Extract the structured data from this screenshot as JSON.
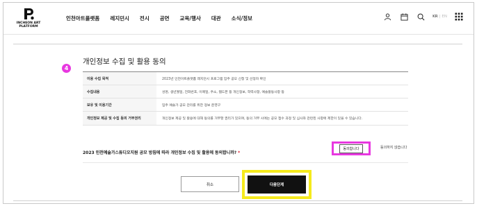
{
  "header": {
    "logo": {
      "line1": "INCHEON ART",
      "line2": "PLATFORM"
    },
    "nav": [
      "인천아트플랫폼",
      "레지던시",
      "전시",
      "공연",
      "교육/행사",
      "대관",
      "소식/정보"
    ],
    "lang": {
      "current": "KR",
      "other": "EN"
    }
  },
  "form": {
    "step": "4",
    "title": "개인정보 수집 및 활용 동의",
    "rows": [
      {
        "label": "이용 수집 목적",
        "value": "2023년 인천아트플랫폼 레지던시 프로그램 입주 공모 신청 및 선정자 확인"
      },
      {
        "label": "수집내용",
        "value": "성명, 생년월일, 전화번호, 이메일, 주소, 웹드폰 등 개인정보, 학력사항, 예술활동사항 등"
      },
      {
        "label": "보유 및 이용기간",
        "value": "입주 예술가 공모 관리를 위한 정보 운영구"
      },
      {
        "label": "개인정보 제공 및 수집 동의 거부권리",
        "value": "개인정보 제공 및 활용에 대해 동의를 거부할 권리가 있으며, 동의 거부 시에는 공모 접수 과정 및 심사와 관련된 사항에 제한이 있을 수 있습니다."
      }
    ],
    "question": "2023 인천예술가스튜디오지원 공모 방침에 따라 개인정보 수집 및 활용에 동의합니까?",
    "required_mark": "*",
    "agree_label": "동의합니다",
    "disagree_label": "동의하지 않습니다",
    "cancel_label": "취소",
    "next_label": "다음단계"
  },
  "colors": {
    "highlight_magenta": "#e838e0",
    "highlight_yellow": "#f5ea1c",
    "primary_button": "#111111"
  }
}
